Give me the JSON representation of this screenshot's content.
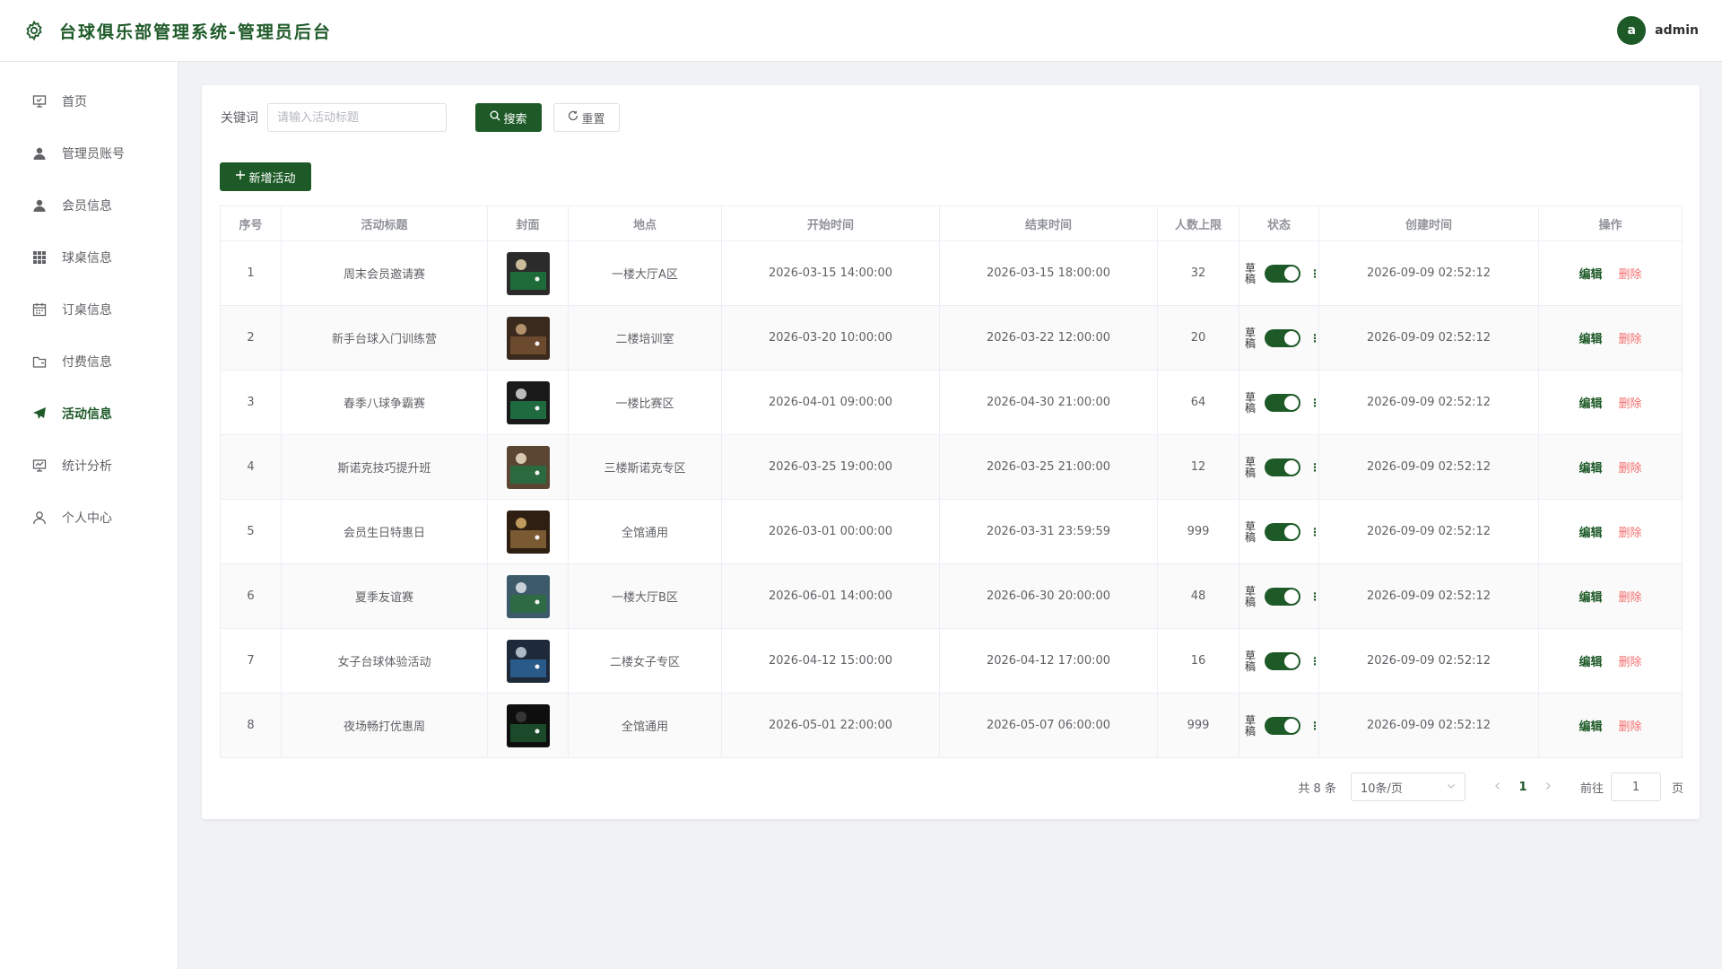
{
  "header": {
    "title": "台球俱乐部管理系统-管理员后台",
    "avatar_letter": "a",
    "username": "admin"
  },
  "sidebar": {
    "items": [
      {
        "label": "首页",
        "icon": "dashboard-icon",
        "active": false
      },
      {
        "label": "管理员账号",
        "icon": "user-icon",
        "active": false
      },
      {
        "label": "会员信息",
        "icon": "user-icon",
        "active": false
      },
      {
        "label": "球桌信息",
        "icon": "grid-icon",
        "active": false
      },
      {
        "label": "订桌信息",
        "icon": "calendar-icon",
        "active": false
      },
      {
        "label": "付费信息",
        "icon": "wallet-icon",
        "active": false
      },
      {
        "label": "活动信息",
        "icon": "send-icon",
        "active": true
      },
      {
        "label": "统计分析",
        "icon": "chart-icon",
        "active": false
      },
      {
        "label": "个人中心",
        "icon": "person-icon",
        "active": false
      }
    ]
  },
  "search": {
    "label": "关键词",
    "placeholder": "请输入活动标题",
    "value": "",
    "search_button": "搜索",
    "reset_button": "重置"
  },
  "toolbar": {
    "add_button": "新增活动"
  },
  "table": {
    "columns": [
      "序号",
      "活动标题",
      "封面",
      "地点",
      "开始时间",
      "结束时间",
      "人数上限",
      "状态",
      "创建时间",
      "操作"
    ],
    "rows": [
      {
        "index": "1",
        "title": "周末会员邀请赛",
        "location": "一楼大厅A区",
        "start": "2026-03-15 14:00:00",
        "end": "2026-03-15 18:00:00",
        "limit": "32",
        "status": "草稿",
        "created": "2026-09-09 02:52:12"
      },
      {
        "index": "2",
        "title": "新手台球入门训练营",
        "location": "二楼培训室",
        "start": "2026-03-20 10:00:00",
        "end": "2026-03-22 12:00:00",
        "limit": "20",
        "status": "草稿",
        "created": "2026-09-09 02:52:12"
      },
      {
        "index": "3",
        "title": "春季八球争霸赛",
        "location": "一楼比赛区",
        "start": "2026-04-01 09:00:00",
        "end": "2026-04-30 21:00:00",
        "limit": "64",
        "status": "草稿",
        "created": "2026-09-09 02:52:12"
      },
      {
        "index": "4",
        "title": "斯诺克技巧提升班",
        "location": "三楼斯诺克专区",
        "start": "2026-03-25 19:00:00",
        "end": "2026-03-25 21:00:00",
        "limit": "12",
        "status": "草稿",
        "created": "2026-09-09 02:52:12"
      },
      {
        "index": "5",
        "title": "会员生日特惠日",
        "location": "全馆通用",
        "start": "2026-03-01 00:00:00",
        "end": "2026-03-31 23:59:59",
        "limit": "999",
        "status": "草稿",
        "created": "2026-09-09 02:52:12"
      },
      {
        "index": "6",
        "title": "夏季友谊赛",
        "location": "一楼大厅B区",
        "start": "2026-06-01 14:00:00",
        "end": "2026-06-30 20:00:00",
        "limit": "48",
        "status": "草稿",
        "created": "2026-09-09 02:52:12"
      },
      {
        "index": "7",
        "title": "女子台球体验活动",
        "location": "二楼女子专区",
        "start": "2026-04-12 15:00:00",
        "end": "2026-04-12 17:00:00",
        "limit": "16",
        "status": "草稿",
        "created": "2026-09-09 02:52:12"
      },
      {
        "index": "8",
        "title": "夜场畅打优惠周",
        "location": "全馆通用",
        "start": "2026-05-01 22:00:00",
        "end": "2026-05-07 06:00:00",
        "limit": "999",
        "status": "草稿",
        "created": "2026-09-09 02:52:12"
      }
    ],
    "edit_label": "编辑",
    "delete_label": "删除"
  },
  "pagination": {
    "total": "共 8 条",
    "page_size": "10条/页",
    "current_page": "1",
    "goto_label": "前往",
    "goto_value": "1",
    "page_unit": "页"
  },
  "colors": {
    "accent": "#1e5a28",
    "danger": "#f56c6c"
  }
}
